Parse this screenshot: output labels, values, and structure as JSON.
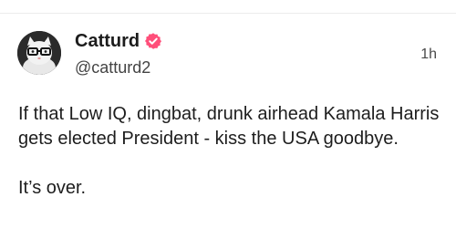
{
  "post": {
    "author": {
      "display_name": "Catturd",
      "handle": "@catturd2",
      "verified": true,
      "avatar_icon": "cat-with-glasses-avatar-icon",
      "verified_icon": "verified-badge-icon"
    },
    "timestamp": "1h",
    "text_paragraph_1": "If that Low IQ, dingbat, drunk airhead Kamala Harris gets elected President - kiss the USA goodbye.",
    "text_paragraph_2": "It’s over."
  },
  "colors": {
    "verified_badge": "#ff4f7a",
    "divider": "#ececec",
    "text_primary": "#1d1d1d",
    "text_secondary": "#444444"
  }
}
